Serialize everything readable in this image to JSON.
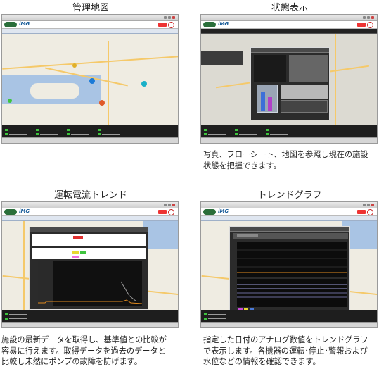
{
  "panels": [
    {
      "title": "管理地図",
      "description": []
    },
    {
      "title": "状態表示",
      "description": [
        "写真、フローシート、地図を参照し現在の施設",
        "状態を把握できます。"
      ]
    },
    {
      "title": "運転電流トレンド",
      "description": [
        "施設の最新データを取得し、基準値との比較が",
        "容易に行えます。取得データを過去のデータと",
        "比較し未然にポンプの故障を防げます。"
      ]
    },
    {
      "title": "トレンドグラフ",
      "description": [
        "指定した日付のアナログ数値をトレンドグラフ",
        "で表示します。各機器の運転･停止･警報および",
        "水位などの情報を確認できます。"
      ]
    }
  ],
  "app": {
    "brand": "ⅰMG"
  },
  "colors": {
    "accent_red": "#c81e1e",
    "status_green": "#3ec43e",
    "trend_orange": "#e08a1e"
  }
}
